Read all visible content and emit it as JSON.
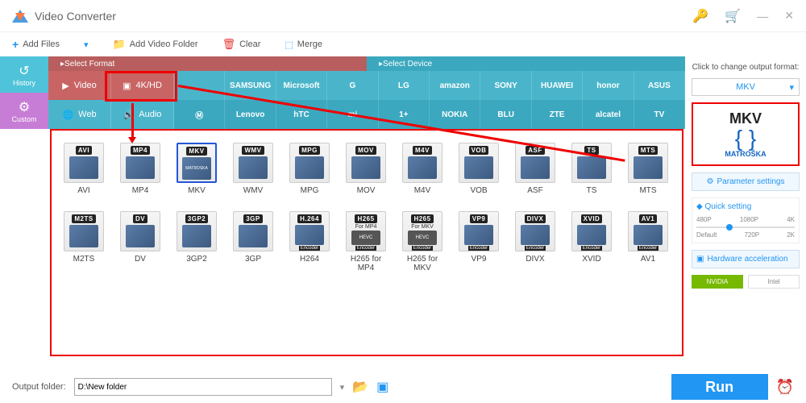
{
  "app": {
    "title": "Video Converter"
  },
  "toolbar": {
    "add_files": "Add Files",
    "add_folder": "Add Video Folder",
    "clear": "Clear",
    "merge": "Merge"
  },
  "leftnav": {
    "history": "History",
    "custom": "Custom"
  },
  "catheader": {
    "select_format": "Select Format",
    "select_device": "Select Device"
  },
  "cats": {
    "video": "Video",
    "fourk": "4K/HD",
    "web": "Web",
    "audio": "Audio"
  },
  "brands_row1": [
    "",
    "SAMSUNG",
    "Microsoft",
    "G",
    "LG",
    "amazon",
    "SONY",
    "HUAWEI",
    "honor",
    "ASUS"
  ],
  "brands_row2": [
    "",
    "Lenovo",
    "hTC",
    "mi",
    "1+",
    "NOKIA",
    "BLU",
    "ZTE",
    "alcatel",
    "TV"
  ],
  "formats": [
    {
      "badge": "AVI",
      "label": "AVI"
    },
    {
      "badge": "MP4",
      "label": "MP4"
    },
    {
      "badge": "MKV",
      "label": "MKV",
      "selected": true,
      "innerText": "MATROSKA"
    },
    {
      "badge": "WMV",
      "label": "WMV"
    },
    {
      "badge": "MPG",
      "label": "MPG"
    },
    {
      "badge": "MOV",
      "label": "MOV"
    },
    {
      "badge": "M4V",
      "label": "M4V"
    },
    {
      "badge": "VOB",
      "label": "VOB"
    },
    {
      "badge": "ASF",
      "label": "ASF"
    },
    {
      "badge": "TS",
      "label": "TS"
    },
    {
      "badge": "MTS",
      "label": "MTS"
    },
    {
      "badge": "M2TS",
      "label": "M2TS"
    },
    {
      "badge": "DV",
      "label": "DV"
    },
    {
      "badge": "3GP2",
      "label": "3GP2"
    },
    {
      "badge": "3GP",
      "label": "3GP"
    },
    {
      "badge": "H.264",
      "label": "H264",
      "enc": true
    },
    {
      "badge": "H265",
      "label": "H265 for MP4",
      "sub": "For MP4",
      "enc": true
    },
    {
      "badge": "H265",
      "label": "H265 for MKV",
      "sub": "For MKV",
      "enc": true
    },
    {
      "badge": "VP9",
      "label": "VP9",
      "enc": true
    },
    {
      "badge": "DIVX",
      "label": "DIVX",
      "enc": true
    },
    {
      "badge": "XVID",
      "label": "XVID",
      "enc": true
    },
    {
      "badge": "AV1",
      "label": "AV1",
      "enc": true
    }
  ],
  "rightpanel": {
    "title": "Click to change output format:",
    "selected": "MKV",
    "preview_big": "MKV",
    "preview_name": "MATROŠKA",
    "param": "Parameter settings",
    "quick": "Quick setting",
    "qmarks_top": [
      "480P",
      "1080P",
      "4K"
    ],
    "qmarks_bot": [
      "Default",
      "720P",
      "2K"
    ],
    "hw": "Hardware acceleration",
    "nvidia": "NVIDIA",
    "intel": "Intel"
  },
  "footer": {
    "label": "Output folder:",
    "value": "D:\\New folder",
    "run": "Run"
  }
}
